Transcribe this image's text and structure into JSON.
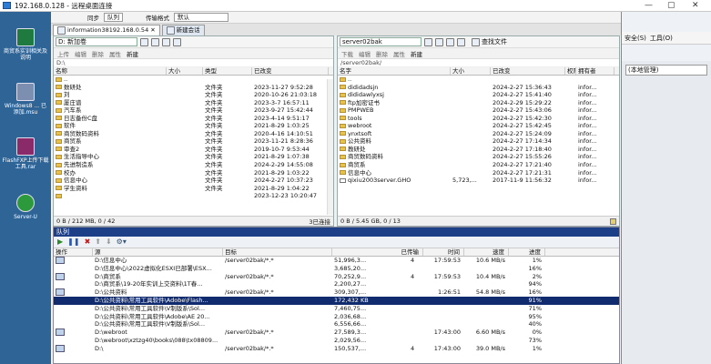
{
  "window": {
    "title": "192.168.0.128 - 远程桌面连接"
  },
  "desktop": {
    "icons": [
      {
        "label": "商贸系实训相关及说明",
        "name": "doc-shortcut-icon"
      },
      {
        "label": "Windows8 ... 已添加.msu",
        "name": "installer-icon"
      },
      {
        "label": "FlashFXP上传下载工具.rar",
        "name": "rar-archive-icon"
      },
      {
        "label": "Server-U",
        "name": "server-u-icon"
      }
    ]
  },
  "bg_window": {
    "menu": [
      "安全(S)",
      "工具(O)"
    ],
    "field": "(本地管理)"
  },
  "app": {
    "toolbar": {
      "sync_label": "同步",
      "queue_label": "队列",
      "link_label": "传输格式",
      "ascii_label": "默认"
    },
    "session_tabs": [
      "information38192.168.0.54",
      "新建会话"
    ],
    "left": {
      "drive": "D: 新加卷",
      "tools": [
        "上传",
        "编辑",
        "删除",
        "属性",
        "新建"
      ],
      "path": "D:\\",
      "columns": [
        "名称",
        "大小",
        "类型",
        "已改变"
      ],
      "rows": [
        {
          "name": "..",
          "size": "",
          "type": "",
          "date": ""
        },
        {
          "name": "数研处",
          "size": "",
          "type": "文件夹",
          "date": "2023-11-27  9:52:28"
        },
        {
          "name": "刘",
          "size": "",
          "type": "文件夹",
          "date": "2020-10-26  21:03:18"
        },
        {
          "name": "厦庄谱",
          "size": "",
          "type": "文件夹",
          "date": "2023-3-7  16:57:11"
        },
        {
          "name": "汽车系",
          "size": "",
          "type": "文件夹",
          "date": "2023-9-27  15:42:44"
        },
        {
          "name": "日志备份C盘",
          "size": "",
          "type": "文件夹",
          "date": "2023-4-14  9:51:17"
        },
        {
          "name": "软件",
          "size": "",
          "type": "文件夹",
          "date": "2021-8-29  1:03:25"
        },
        {
          "name": "商贸数码资料",
          "size": "",
          "type": "文件夹",
          "date": "2020-4-16  14:10:51"
        },
        {
          "name": "商贸系",
          "size": "",
          "type": "文件夹",
          "date": "2023-11-21  8:28:36"
        },
        {
          "name": "审查2",
          "size": "",
          "type": "文件夹",
          "date": "2019-10-7  9:53:44"
        },
        {
          "name": "生活指导中心",
          "size": "",
          "type": "文件夹",
          "date": "2021-8-29  1:07:38"
        },
        {
          "name": "先进制造系",
          "size": "",
          "type": "文件夹",
          "date": "2024-2-29  14:55:08"
        },
        {
          "name": "校办",
          "size": "",
          "type": "文件夹",
          "date": "2021-8-29  1:03:22"
        },
        {
          "name": "信息中心",
          "size": "",
          "type": "文件夹",
          "date": "2024-2-27  10:37:23"
        },
        {
          "name": "学生资料",
          "size": "",
          "type": "文件夹",
          "date": "2021-8-29  1:04:22"
        },
        {
          "name": "",
          "size": "",
          "type": "",
          "date": "2023-12-23  10:20:47"
        }
      ],
      "status_left": "0 B / 212 MB, 0 / 42",
      "status_right": "3已连接"
    },
    "right": {
      "drive": "server02bak",
      "find_label": "查找文件",
      "tools": [
        "下载",
        "编辑",
        "删除",
        "属性",
        "新建"
      ],
      "path": "/server02bak/",
      "columns": [
        "名字",
        "大小",
        "已改变",
        "权限",
        "拥有者"
      ],
      "rows": [
        {
          "name": "..",
          "size": "",
          "date": "",
          "perm": "",
          "owner": "",
          "file": false
        },
        {
          "name": "dididadsjn",
          "size": "",
          "date": "2024-2-27  15:36:43",
          "perm": "",
          "owner": "infor...",
          "file": false
        },
        {
          "name": "dididawlyxsj",
          "size": "",
          "date": "2024-2-27  15:41:40",
          "perm": "",
          "owner": "infor...",
          "file": false
        },
        {
          "name": "ftp加密证书",
          "size": "",
          "date": "2024-2-29  15:29:22",
          "perm": "",
          "owner": "infor...",
          "file": false
        },
        {
          "name": "PMPWEB",
          "size": "",
          "date": "2024-2-27  15:43:06",
          "perm": "",
          "owner": "infor...",
          "file": false
        },
        {
          "name": "tools",
          "size": "",
          "date": "2024-2-27  15:42:30",
          "perm": "",
          "owner": "infor...",
          "file": false
        },
        {
          "name": "webroot",
          "size": "",
          "date": "2024-2-27  15:42:45",
          "perm": "",
          "owner": "infor...",
          "file": false
        },
        {
          "name": "ynxtsoft",
          "size": "",
          "date": "2024-2-27  15:24:09",
          "perm": "",
          "owner": "infor...",
          "file": false
        },
        {
          "name": "公共资料",
          "size": "",
          "date": "2024-2-27  17:14:34",
          "perm": "",
          "owner": "infor...",
          "file": false
        },
        {
          "name": "教研处",
          "size": "",
          "date": "2024-2-27  17:18:40",
          "perm": "",
          "owner": "infor...",
          "file": false
        },
        {
          "name": "商贸数码资料",
          "size": "",
          "date": "2024-2-27  15:55:26",
          "perm": "",
          "owner": "infor...",
          "file": false
        },
        {
          "name": "商贸系",
          "size": "",
          "date": "2024-2-27  17:21:40",
          "perm": "",
          "owner": "infor...",
          "file": false
        },
        {
          "name": "信息中心",
          "size": "",
          "date": "2024-2-27  17:21:31",
          "perm": "",
          "owner": "infor...",
          "file": false
        },
        {
          "name": "qixiu2003server.GHO",
          "size": "5,723,...",
          "date": "2017-11-9  11:56:32",
          "perm": "",
          "owner": "infor...",
          "file": true
        }
      ],
      "status_left": "0 B / 5.45 GB, 0 / 13"
    },
    "queue": {
      "title": "队列",
      "columns": [
        "操作",
        "源",
        "目标",
        "已传输",
        "时间",
        "速度",
        "进度"
      ],
      "rows": [
        {
          "op": "",
          "src": "D:\\信息中心",
          "dst": "/server02bak/*.*",
          "bytes": "51,996,3...",
          "mark": "4",
          "time": "17:59:53",
          "speed": "10.6 MB/s",
          "pct": "1%",
          "sel": false
        },
        {
          "op": "",
          "src": "D:\\信息中心\\2022虚拟化ESXI已部署\\ESX...",
          "dst": "",
          "bytes": "3,685,20...",
          "mark": "",
          "time": "",
          "speed": "",
          "pct": "16%",
          "sel": false
        },
        {
          "op": "",
          "src": "D:\\商贸系",
          "dst": "/server02bak/*.*",
          "bytes": "70,252,9...",
          "mark": "4",
          "time": "17:59:53",
          "speed": "10.4 MB/s",
          "pct": "2%",
          "sel": false
        },
        {
          "op": "",
          "src": "D:\\商贸系\\19-20年实训上交资料\\1T春...",
          "dst": "",
          "bytes": "2,200,27...",
          "mark": "",
          "time": "",
          "speed": "",
          "pct": "94%",
          "sel": false
        },
        {
          "op": "",
          "src": "D:\\公共资料",
          "dst": "/server02bak/*.*",
          "bytes": "309,307,...",
          "mark": "",
          "time": "1:26:51",
          "speed": "54.8 MB/s",
          "pct": "16%",
          "sel": false
        },
        {
          "op": "",
          "src": "D:\\公共资料\\常用工具软件\\Adobe\\Flash...",
          "dst": "",
          "bytes": "172,432 KB",
          "mark": "",
          "time": "",
          "speed": "",
          "pct": "91%",
          "sel": true
        },
        {
          "op": "",
          "src": "D:\\公共资料\\常用工具软件\\V制版系\\Sol...",
          "dst": "",
          "bytes": "7,460,75...",
          "mark": "",
          "time": "",
          "speed": "",
          "pct": "71%",
          "sel": false
        },
        {
          "op": "",
          "src": "D:\\公共资料\\常用工具软件\\Adobe\\AE 20...",
          "dst": "",
          "bytes": "2,036,68...",
          "mark": "",
          "time": "",
          "speed": "",
          "pct": "95%",
          "sel": false
        },
        {
          "op": "",
          "src": "D:\\公共资料\\常用工具软件\\V制版系\\Sol...",
          "dst": "",
          "bytes": "6,556,66...",
          "mark": "",
          "time": "",
          "speed": "",
          "pct": "40%",
          "sel": false
        },
        {
          "op": "",
          "src": "D:\\webroot",
          "dst": "/server02bak/*.*",
          "bytes": "27,589,3...",
          "mark": "",
          "time": "17:43:00",
          "speed": "6.60 MB/s",
          "pct": "0%",
          "sel": false
        },
        {
          "op": "",
          "src": "D:\\webroot\\xztzg40\\books\\088\\tx08809...",
          "dst": "",
          "bytes": "2,029,56...",
          "mark": "",
          "time": "",
          "speed": "",
          "pct": "73%",
          "sel": false
        },
        {
          "op": "",
          "src": "D:\\",
          "dst": "/server02bak/*.*",
          "bytes": "150,537,...",
          "mark": "4",
          "time": "17:43:00",
          "speed": "39.0 MB/s",
          "pct": "1%",
          "sel": false
        }
      ]
    }
  }
}
